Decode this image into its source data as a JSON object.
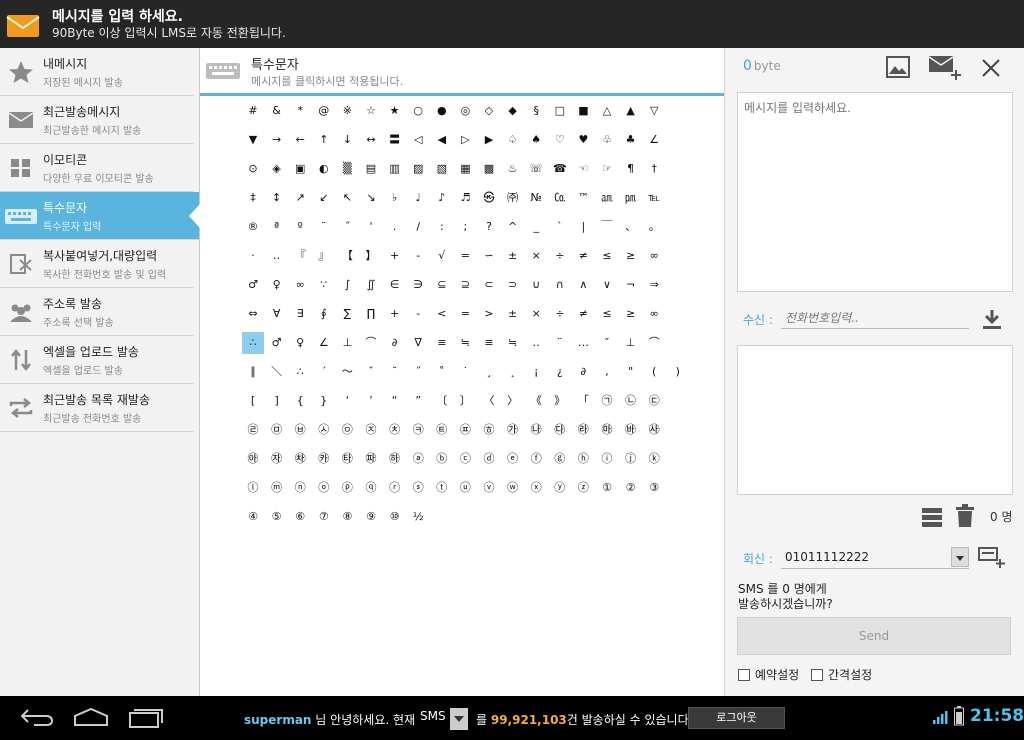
{
  "header": {
    "title": "메시지를 입력 하세요.",
    "subtitle": "90Byte 이상 입력시 LMS로 자동 전환됩니다."
  },
  "sidebar": {
    "items": [
      {
        "label": "내메시지",
        "sub": "저장된 메시지 발송",
        "icon": "star-icon"
      },
      {
        "label": "최근발송메시지",
        "sub": "최근발송한 메시지 발송",
        "icon": "envelope-icon"
      },
      {
        "label": "이모티콘",
        "sub": "다양한 무료 이모티콘 발송",
        "icon": "grid-icon"
      },
      {
        "label": "특수문자",
        "sub": "특수문자 입력",
        "icon": "keyboard-icon",
        "active": true
      },
      {
        "label": "복사붙여넣거,대량입력",
        "sub": "복사한 전화번호 발송 및 입력",
        "icon": "paste-icon"
      },
      {
        "label": "주소록 발송",
        "sub": "주소록 선택 발송",
        "icon": "contacts-icon"
      },
      {
        "label": "엑셀을 업로드 발송",
        "sub": "엑셀을 업로드 발송",
        "icon": "upload-arrows-icon"
      },
      {
        "label": "최근발송 목록 재발송",
        "sub": "최근발송 전화번호 발송",
        "icon": "repeat-icon"
      }
    ]
  },
  "panel": {
    "title": "특수문자",
    "subtitle": "메시지를 클릭하시면 적용됩니다."
  },
  "symbols": [
    [
      "#",
      "&",
      "*",
      "@",
      "※",
      "☆",
      "★",
      "○",
      "●",
      "◎",
      "◇",
      "◆",
      "§",
      "□",
      "■",
      "△",
      "▲",
      "▽"
    ],
    [
      "▼",
      "→",
      "←",
      "↑",
      "↓",
      "↔",
      "〓",
      "◁",
      "◀",
      "▷",
      "▶",
      "♤",
      "♠",
      "♡",
      "♥",
      "♧",
      "♣",
      "∠"
    ],
    [
      "⊙",
      "◈",
      "▣",
      "◐",
      "▒",
      "▤",
      "▥",
      "▨",
      "▧",
      "▦",
      "▩",
      "♨",
      "☏",
      "☎",
      "☜",
      "☞",
      "¶",
      "†"
    ],
    [
      "‡",
      "↕",
      "↗",
      "↙",
      "↖",
      "↘",
      "♭",
      "♩",
      "♪",
      "♬",
      "㉿",
      "㈜",
      "№",
      "㏇",
      "™",
      "㏂",
      "㏘",
      "℡"
    ],
    [
      "®",
      "ª",
      "º",
      "¨",
      "˝",
      "'",
      ".",
      "/",
      ":",
      ";",
      "?",
      "^",
      "_",
      "`",
      "|",
      "￣",
      "、",
      "。"
    ],
    [
      "·",
      "‥",
      "『",
      "』",
      "【",
      "】",
      "+",
      "-",
      "√",
      "=",
      "∽",
      "±",
      "×",
      "÷",
      "≠",
      "≤",
      "≥",
      "∞"
    ],
    [
      "♂",
      "♀",
      "∞",
      "∵",
      "∫",
      "∬",
      "∈",
      "∋",
      "⊆",
      "⊇",
      "⊂",
      "⊃",
      "∪",
      "∩",
      "∧",
      "∨",
      "¬",
      "⇒"
    ],
    [
      "⇔",
      "∀",
      "∃",
      "∮",
      "∑",
      "∏",
      "+",
      "-",
      "<",
      "=",
      ">",
      "±",
      "×",
      "÷",
      "≠",
      "≤",
      "≥",
      "∞"
    ],
    [
      "∴",
      "♂",
      "♀",
      "∠",
      "⊥",
      "⌒",
      "∂",
      "∇",
      "≡",
      "≒",
      "≡",
      "≒",
      "‥",
      "¨",
      "…",
      "″",
      "⊥",
      "⌒"
    ],
    [
      "∥",
      "＼",
      "∴",
      "´",
      "～",
      "ˇ",
      "˘",
      "˝",
      "˚",
      "˙",
      "¸",
      "˛",
      "¡",
      "¿",
      "∂",
      ",",
      "\"",
      "(",
      ")"
    ],
    [
      "[",
      "]",
      "{",
      "}",
      "‘",
      "’",
      "“",
      "”",
      "〔",
      "〕",
      "〈",
      "〉",
      "《",
      "》",
      "「",
      "㉠",
      "㉡",
      "㉢"
    ],
    [
      "㉣",
      "㉤",
      "㉥",
      "㉦",
      "㉧",
      "㉨",
      "㉩",
      "㉪",
      "㉫",
      "㉬",
      "㉭",
      "㉮",
      "㉯",
      "㉰",
      "㉱",
      "㉲",
      "㉳",
      "㉴"
    ],
    [
      "㉵",
      "㉶",
      "㉷",
      "㉸",
      "㉹",
      "㉺",
      "㉻",
      "ⓐ",
      "ⓑ",
      "ⓒ",
      "ⓓ",
      "ⓔ",
      "ⓕ",
      "ⓖ",
      "ⓗ",
      "ⓘ",
      "ⓙ",
      "ⓚ"
    ],
    [
      "ⓛ",
      "ⓜ",
      "ⓝ",
      "ⓞ",
      "ⓟ",
      "ⓠ",
      "ⓡ",
      "ⓢ",
      "ⓣ",
      "ⓤ",
      "ⓥ",
      "ⓦ",
      "ⓧ",
      "ⓨ",
      "ⓩ",
      "①",
      "②",
      "③"
    ],
    [
      "④",
      "⑤",
      "⑥",
      "⑦",
      "⑧",
      "⑨",
      "⑩",
      "½"
    ]
  ],
  "selected_symbol": "∴",
  "compose": {
    "byte_count": "0",
    "byte_unit": "byte",
    "message_placeholder": "메시지를 입력하세요.",
    "recipient_label": "수신 :",
    "recipient_placeholder": "전화번호입력..",
    "recipient_count": "0 명",
    "reply_label": "회신 :",
    "reply_number": "01011112222",
    "confirm_line1": "SMS 를 0 명에게",
    "confirm_line2": "발송하시겠습니까?",
    "send_label": "Send",
    "reserve_label": "예약설정",
    "interval_label": "간격설정"
  },
  "footer": {
    "user": "superman",
    "greeting": " 님 안녕하세요. 현재",
    "sms_type": "SMS",
    "amount_prefix": "를 ",
    "amount": "99,921,103",
    "amount_suffix": "건 발송하실 수 있습니다.",
    "logout_label": "로그아웃",
    "clock": "21:58"
  },
  "colors": {
    "accent": "#5ab4dd",
    "topbar": "#262626",
    "amount": "#f2b033"
  }
}
